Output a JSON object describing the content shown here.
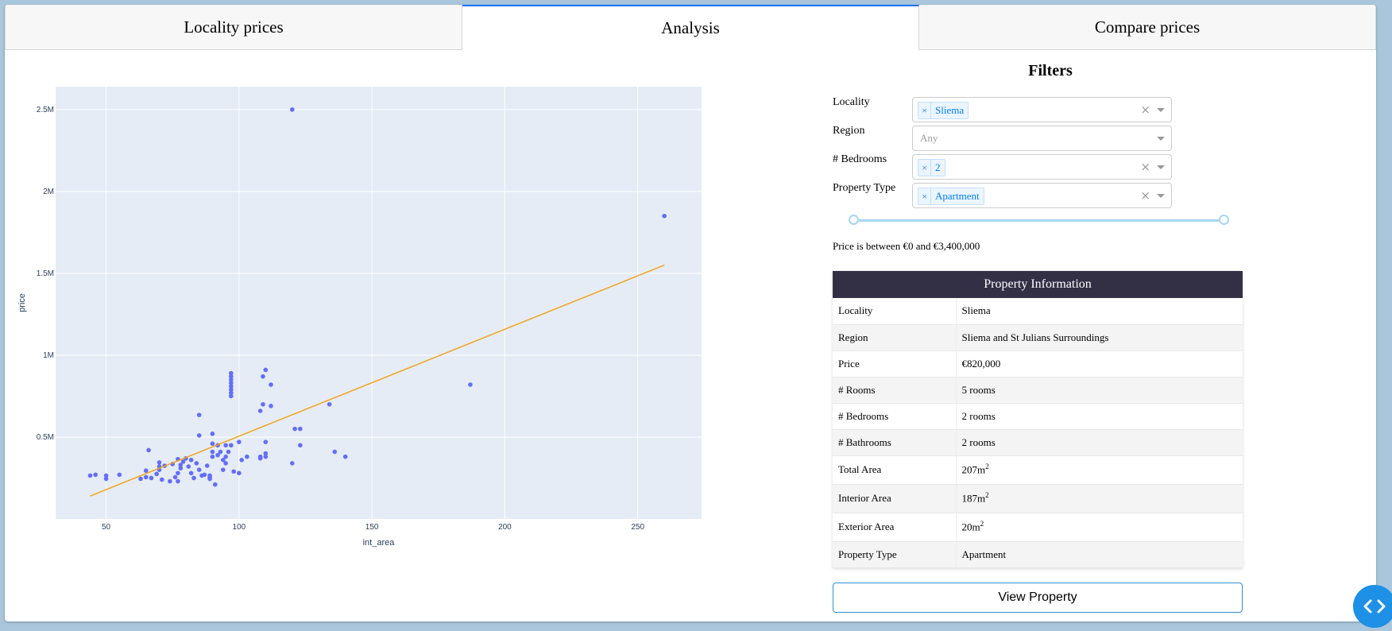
{
  "tabs": [
    {
      "label": "Locality prices",
      "active": false
    },
    {
      "label": "Analysis",
      "active": true
    },
    {
      "label": "Compare prices",
      "active": false
    }
  ],
  "filters": {
    "title": "Filters",
    "locality": {
      "label": "Locality",
      "selected": "Sliema"
    },
    "region": {
      "label": "Region",
      "placeholder": "Any"
    },
    "bedrooms": {
      "label": "# Bedrooms",
      "selected": "2"
    },
    "property_type": {
      "label": "Property Type",
      "selected": "Apartment"
    },
    "price_range": {
      "min": 0,
      "max": 3400000,
      "text": "Price is between €0 and €3,400,000"
    }
  },
  "property_info": {
    "title": "Property Information",
    "rows": [
      {
        "label": "Locality",
        "value": "Sliema"
      },
      {
        "label": "Region",
        "value": "Sliema and St Julians Surroundings"
      },
      {
        "label": "Price",
        "value": "€820,000"
      },
      {
        "label": "# Rooms",
        "value": "5 rooms"
      },
      {
        "label": "# Bedrooms",
        "value": "2 rooms"
      },
      {
        "label": "# Bathrooms",
        "value": "2 rooms"
      },
      {
        "label": "Total Area",
        "value": "207m",
        "sup": "2"
      },
      {
        "label": "Interior Area",
        "value": "187m",
        "sup": "2"
      },
      {
        "label": "Exterior Area",
        "value": "20m",
        "sup": "2"
      },
      {
        "label": "Property Type",
        "value": "Apartment"
      }
    ]
  },
  "view_button": "View Property",
  "colors": {
    "points": "#636efa",
    "trendline": "#f2a41c",
    "plot_bg": "#e5ecf6",
    "header": "#333046"
  },
  "chart_data": {
    "type": "scatter",
    "xlabel": "int_area",
    "ylabel": "price",
    "xlim": [
      31,
      274
    ],
    "ylim": [
      0,
      2640000
    ],
    "xticks": [
      50,
      100,
      150,
      200,
      250
    ],
    "yticks": [
      500000,
      1000000,
      1500000,
      2000000,
      2500000
    ],
    "ytick_labels": [
      "0.5M",
      "1M",
      "1.5M",
      "2M",
      "2.5M"
    ],
    "points": [
      [
        44,
        265000
      ],
      [
        46,
        270000
      ],
      [
        50,
        245000
      ],
      [
        50,
        265000
      ],
      [
        55,
        270000
      ],
      [
        63,
        245000
      ],
      [
        65,
        255000
      ],
      [
        65,
        295000
      ],
      [
        66,
        420000
      ],
      [
        67,
        250000
      ],
      [
        69,
        275000
      ],
      [
        70,
        300000
      ],
      [
        70,
        320000
      ],
      [
        70,
        345000
      ],
      [
        71,
        240000
      ],
      [
        72,
        325000
      ],
      [
        74,
        230000
      ],
      [
        75,
        335000
      ],
      [
        76,
        255000
      ],
      [
        77,
        280000
      ],
      [
        77,
        365000
      ],
      [
        77,
        230000
      ],
      [
        78,
        310000
      ],
      [
        78,
        330000
      ],
      [
        79,
        350000
      ],
      [
        80,
        370000
      ],
      [
        81,
        320000
      ],
      [
        82,
        280000
      ],
      [
        82,
        360000
      ],
      [
        83,
        250000
      ],
      [
        84,
        340000
      ],
      [
        85,
        300000
      ],
      [
        85,
        510000
      ],
      [
        85,
        635000
      ],
      [
        86,
        265000
      ],
      [
        87,
        270000
      ],
      [
        88,
        325000
      ],
      [
        89,
        255000
      ],
      [
        89,
        245000
      ],
      [
        89,
        265000
      ],
      [
        90,
        380000
      ],
      [
        90,
        410000
      ],
      [
        90,
        460000
      ],
      [
        90,
        520000
      ],
      [
        91,
        210000
      ],
      [
        92,
        390000
      ],
      [
        92,
        450000
      ],
      [
        93,
        410000
      ],
      [
        94,
        300000
      ],
      [
        94,
        360000
      ],
      [
        95,
        340000
      ],
      [
        95,
        380000
      ],
      [
        95,
        450000
      ],
      [
        96,
        410000
      ],
      [
        97,
        750000
      ],
      [
        97,
        770000
      ],
      [
        97,
        790000
      ],
      [
        97,
        810000
      ],
      [
        97,
        830000
      ],
      [
        97,
        850000
      ],
      [
        97,
        870000
      ],
      [
        97,
        890000
      ],
      [
        97,
        450000
      ],
      [
        98,
        290000
      ],
      [
        100,
        470000
      ],
      [
        100,
        280000
      ],
      [
        101,
        360000
      ],
      [
        103,
        380000
      ],
      [
        108,
        380000
      ],
      [
        108,
        660000
      ],
      [
        108,
        370000
      ],
      [
        109,
        700000
      ],
      [
        109,
        870000
      ],
      [
        110,
        910000
      ],
      [
        110,
        470000
      ],
      [
        110,
        400000
      ],
      [
        110,
        380000
      ],
      [
        112,
        820000
      ],
      [
        112,
        690000
      ],
      [
        120,
        2500000
      ],
      [
        120,
        340000
      ],
      [
        121,
        550000
      ],
      [
        123,
        550000
      ],
      [
        123,
        450000
      ],
      [
        134,
        700000
      ],
      [
        136,
        410000
      ],
      [
        140,
        380000
      ],
      [
        187,
        820000
      ],
      [
        260,
        1850000
      ]
    ],
    "trendline": [
      [
        44,
        140000
      ],
      [
        260,
        1550000
      ]
    ]
  }
}
